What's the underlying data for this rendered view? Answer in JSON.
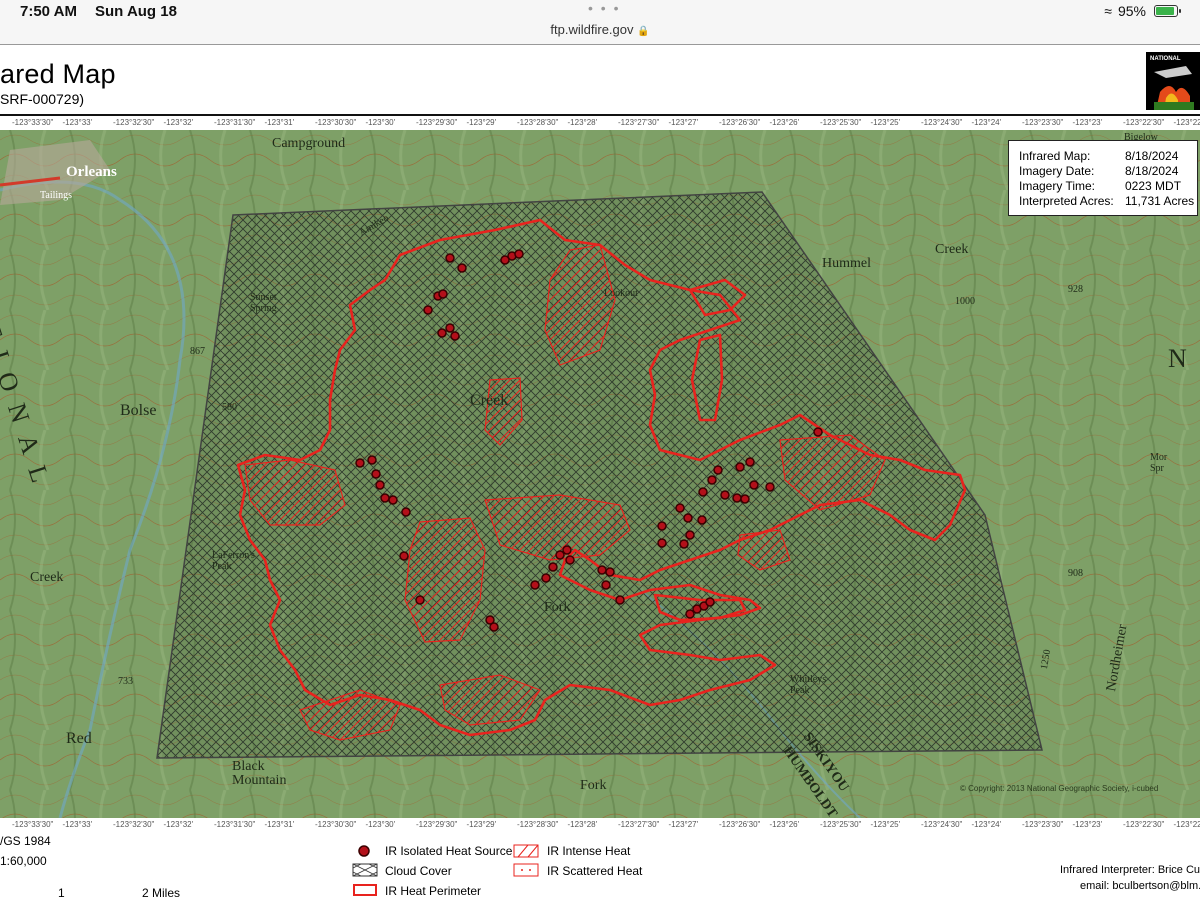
{
  "status_bar": {
    "time": "7:50 AM",
    "date": "Sun Aug 18",
    "url": "ftp.wildfire.gov",
    "battery": "95%",
    "battery_level": 0.95
  },
  "header": {
    "title": "ared Map",
    "subtitle": "SRF-000729)",
    "logo_text": "NATIONAL"
  },
  "coords_top": [
    "-123°33'30\"",
    "-123°33'",
    "-123°32'30\"",
    "-123°32'",
    "-123°31'30\"",
    "-123°31'",
    "-123°30'30\"",
    "-123°30'",
    "-123°29'30\"",
    "-123°29'",
    "-123°28'30\"",
    "-123°28'",
    "-123°27'30\"",
    "-123°27'",
    "-123°26'30\"",
    "-123°26'",
    "-123°25'30\"",
    "-123°25'",
    "-123°24'30\"",
    "-123°24'",
    "-123°23'30\"",
    "-123°23'",
    "-123°22'30\"",
    "-123°22'"
  ],
  "coords_bottom": [
    "-123°33'30\"",
    "-123°33'",
    "-123°32'30\"",
    "-123°32'",
    "-123°31'30\"",
    "-123°31'",
    "-123°30'30\"",
    "-123°30'",
    "-123°29'30\"",
    "-123°29'",
    "-123°28'30\"",
    "-123°28'",
    "-123°27'30\"",
    "-123°27'",
    "-123°26'30\"",
    "-123°26'",
    "-123°25'30\"",
    "-123°25'",
    "-123°24'30\"",
    "-123°24'",
    "-123°23'30\"",
    "-123°23'",
    "-123°22'30\"",
    "-123°22'"
  ],
  "info_box": {
    "rows": [
      {
        "key": "Infrared Map:",
        "value": "8/18/2024"
      },
      {
        "key": "Imagery Date:",
        "value": "8/18/2024"
      },
      {
        "key": "Imagery Time:",
        "value": "0223 MDT"
      },
      {
        "key": "Interpreted Acres:",
        "value": "11,731 Acres"
      }
    ]
  },
  "map_labels": {
    "orleans": "Orleans",
    "campground": "Campground",
    "tailings": "Tailings",
    "bolse": "Bolse",
    "lafferon_peak": "LaFerron's\nPeak",
    "black_mountain": "Black\nMountain",
    "red": "Red",
    "creek_left": "Creek",
    "creek_center": "Creek",
    "fork_center": "Fork",
    "fork_bottom": "Fork",
    "whitleys_peak": "Whitleys\nPeak",
    "siskiyou": "SISKIYOU",
    "humboldt": "HUMBOLDT",
    "hummel_creek": "Hummel",
    "creek_right": "Creek",
    "nordheimer": "Nordheimer",
    "natl_letters": "ATIONAL",
    "n_right": "N",
    "elev_908": "908",
    "elev_1250": "1250",
    "elev_733": "733",
    "elev_867": "867",
    "elev_1000": "1000",
    "elev_928": "928",
    "elev_580": "580",
    "sunset_spring": "Sunset\nSpring",
    "lookout": "Lookout",
    "bigelow": "Bigelow",
    "mor_spr": "Mor\nSpr",
    "amtrak": "Amikeo"
  },
  "copyright": "© Copyright: 2013 National Geographic Society, i-cubed",
  "legend": {
    "datum": "/GS 1984",
    "scale": "1:60,000",
    "scale_1": "1",
    "scale_2": "2 Miles",
    "isolated_heat": "IR Isolated Heat Source",
    "cloud_cover": "Cloud Cover",
    "heat_perimeter": "IR Heat Perimeter",
    "intense_heat": "IR Intense Heat",
    "scattered_heat": "IR Scattered Heat",
    "interpreter": "Infrared Interpreter: Brice Culb",
    "email": "email: bculbertson@blm.g"
  },
  "colors": {
    "terrain": "#7fa26a",
    "perimeter": "#e8231e",
    "heat_dot": "#b3101a",
    "hatch": "#2d3b2a"
  }
}
